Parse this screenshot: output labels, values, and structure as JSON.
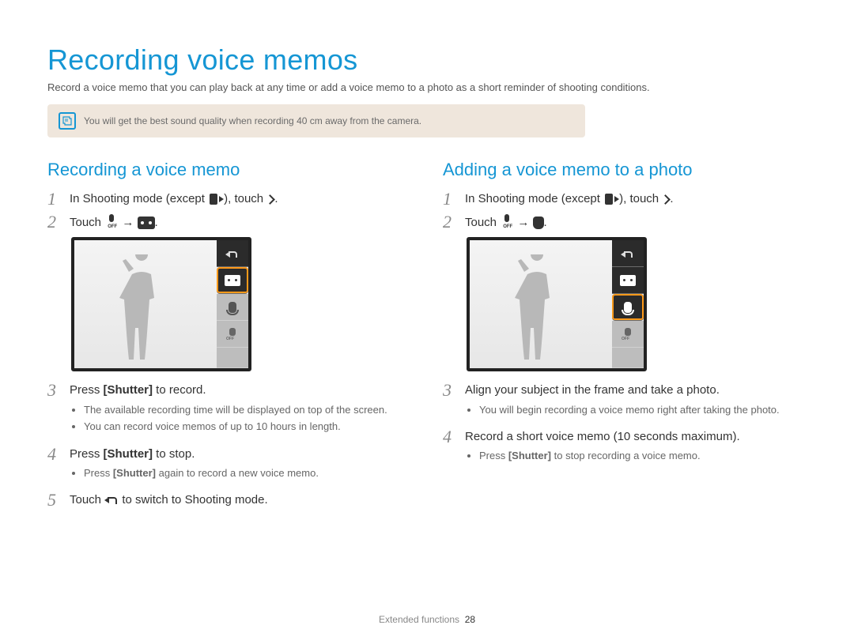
{
  "title": "Recording voice memos",
  "intro": "Record a voice memo that you can play back at any time or add a voice memo to a photo as a short reminder of shooting conditions.",
  "tip": "You will get the best sound quality when recording 40 cm away from the camera.",
  "left": {
    "heading": "Recording a voice memo",
    "steps": {
      "s1_a": "In Shooting mode (except ",
      "s1_b": "), touch ",
      "s1_c": ".",
      "s2_a": "Touch ",
      "s2_b": ".",
      "s3": "Press ",
      "s3_bold": "[Shutter]",
      "s3_after": " to record.",
      "s3_sub1": "The available recording time will be displayed on top of the screen.",
      "s3_sub2": "You can record voice memos of up to 10 hours in length.",
      "s4": "Press ",
      "s4_bold": "[Shutter]",
      "s4_after": " to stop.",
      "s4_sub1a": "Press ",
      "s4_sub1b": "[Shutter]",
      "s4_sub1c": " again to record a new voice memo.",
      "s5_a": "Touch ",
      "s5_b": " to switch to Shooting mode."
    }
  },
  "right": {
    "heading": "Adding a voice memo to a photo",
    "steps": {
      "s1_a": "In Shooting mode (except ",
      "s1_b": "), touch ",
      "s1_c": ".",
      "s2_a": "Touch ",
      "s2_b": ".",
      "s3": "Align your subject in the frame and take a photo.",
      "s3_sub1": "You will begin recording a voice memo right after taking the photo.",
      "s4": "Record a short voice memo (10 seconds maximum).",
      "s4_sub1a": "Press ",
      "s4_sub1b": "[Shutter]",
      "s4_sub1c": " to stop recording a voice memo."
    }
  },
  "footer": {
    "section": "Extended functions",
    "page": "28"
  }
}
